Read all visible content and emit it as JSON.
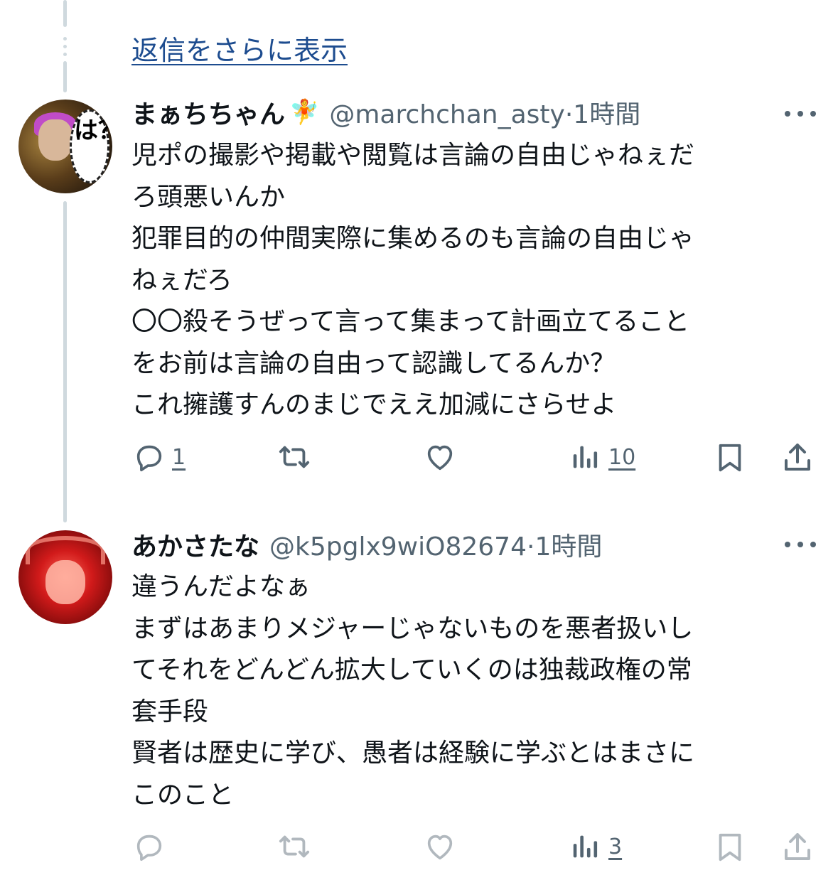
{
  "thread": {
    "show_more_label": "返信をさらに表示"
  },
  "tweets": [
    {
      "display_name": "まぁちちゃん",
      "name_emoji": "🧚",
      "handle": "@marchchan_asty",
      "time": "1時間",
      "avatar_text": "は？",
      "body": "児ポの撮影や掲載や閲覧は言論の自由じゃねぇだ\nろ頭悪いんか\n犯罪目的の仲間実際に集めるのも言論の自由じゃ\nねぇだろ\n〇〇殺そうぜって言って集まって計画立てること\nをお前は言論の自由って認識してるんか？\nこれ擁護すんのまじでええ加減にさらせよ",
      "actions": {
        "reply_count": "1",
        "retweet_count": "",
        "like_count": "",
        "views_count": "10"
      }
    },
    {
      "display_name": "あかさたな",
      "handle": "@k5pglx9wiO82674",
      "time": "1時間",
      "body": "違うんだよなぁ\nまずはあまりメジャーじゃないものを悪者扱いし\nてそれをどんどん拡大していくのは独裁政権の常\n套手段\n賢者は歴史に学び、愚者は経験に学ぶとはまさに\nこのこと",
      "actions": {
        "reply_count": "",
        "retweet_count": "",
        "like_count": "",
        "views_count": "3"
      }
    }
  ],
  "icons": {
    "reply": "reply-icon",
    "retweet": "retweet-icon",
    "like": "heart-icon",
    "views": "views-icon",
    "bookmark": "bookmark-icon",
    "share": "share-icon",
    "more": "more-icon"
  },
  "colors": {
    "link": "#1d4c8f",
    "muted": "#536471",
    "text": "#0f1419",
    "thread_line": "#cfd9de"
  }
}
